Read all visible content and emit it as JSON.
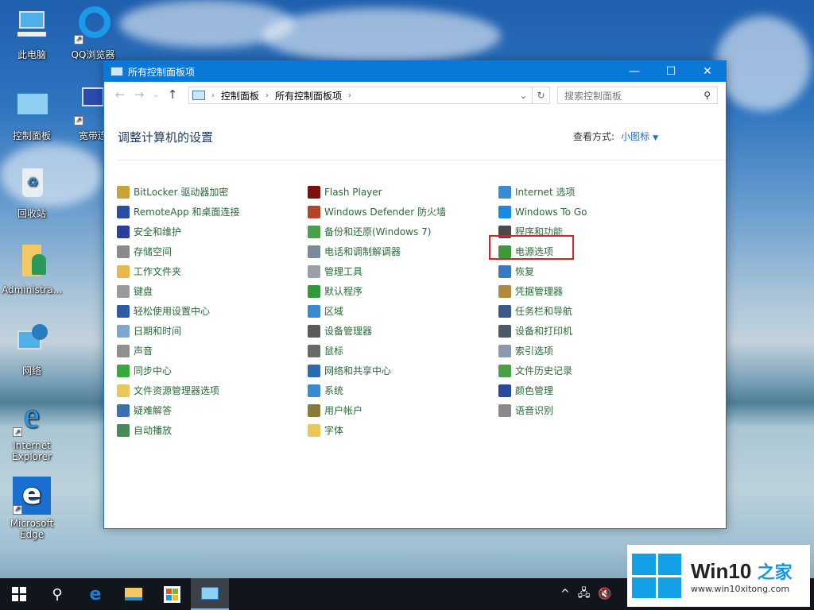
{
  "desktop": {
    "icons": [
      {
        "label": "此电脑",
        "icon": "this-pc-icon"
      },
      {
        "label": "QQ浏览器",
        "icon": "qq-browser-icon"
      },
      {
        "label": "控制面板",
        "icon": "control-panel-icon"
      },
      {
        "label": "宽带连",
        "icon": "broadband-icon"
      },
      {
        "label": "回收站",
        "icon": "recycle-bin-icon"
      },
      {
        "label": "Administra...",
        "icon": "user-folder-icon"
      },
      {
        "label": "网络",
        "icon": "network-icon"
      },
      {
        "label": "Internet Explorer",
        "icon": "ie-icon"
      },
      {
        "label": "Microsoft Edge",
        "icon": "edge-icon"
      }
    ]
  },
  "window": {
    "title": "所有控制面板项",
    "controls": {
      "minimize": "—",
      "maximize": "☐",
      "close": "✕"
    },
    "nav": {
      "back": "←",
      "forward": "→",
      "recent": "⌄",
      "up": "↑"
    },
    "breadcrumb": [
      "控制面板",
      "所有控制面板项"
    ],
    "search_placeholder": "搜索控制面板",
    "heading": "调整计算机的设置",
    "view_by_label": "查看方式:",
    "view_by_value": "小图标",
    "highlighted_item": "电源选项",
    "columns": [
      [
        {
          "label": "BitLocker 驱动器加密",
          "icon": "bitlocker-icon",
          "color": "#c9a23a"
        },
        {
          "label": "RemoteApp 和桌面连接",
          "icon": "remoteapp-icon",
          "color": "#2a4fa0"
        },
        {
          "label": "安全和维护",
          "icon": "flag-icon",
          "color": "#2a3f9a"
        },
        {
          "label": "存储空间",
          "icon": "storage-icon",
          "color": "#8a8a8a"
        },
        {
          "label": "工作文件夹",
          "icon": "work-folder-icon",
          "color": "#e8b84a"
        },
        {
          "label": "键盘",
          "icon": "keyboard-icon",
          "color": "#9a9a9a"
        },
        {
          "label": "轻松使用设置中心",
          "icon": "ease-of-access-icon",
          "color": "#2f5aa8"
        },
        {
          "label": "日期和时间",
          "icon": "clock-icon",
          "color": "#7fa6cf"
        },
        {
          "label": "声音",
          "icon": "speaker-icon",
          "color": "#8f8f8f"
        },
        {
          "label": "同步中心",
          "icon": "sync-icon",
          "color": "#3aa83a"
        },
        {
          "label": "文件资源管理器选项",
          "icon": "folder-options-icon",
          "color": "#e8c85a"
        },
        {
          "label": "疑难解答",
          "icon": "troubleshoot-icon",
          "color": "#3a6fb0"
        },
        {
          "label": "自动播放",
          "icon": "autoplay-icon",
          "color": "#4a8a5a"
        }
      ],
      [
        {
          "label": "Flash Player",
          "icon": "flash-icon",
          "color": "#7a1010"
        },
        {
          "label": "Windows Defender 防火墙",
          "icon": "firewall-icon",
          "color": "#b0452a"
        },
        {
          "label": "备份和还原(Windows 7)",
          "icon": "backup-icon",
          "color": "#4aa048"
        },
        {
          "label": "电话和调制解调器",
          "icon": "phone-icon",
          "color": "#7a8a9a"
        },
        {
          "label": "管理工具",
          "icon": "admin-tools-icon",
          "color": "#9aa0a8"
        },
        {
          "label": "默认程序",
          "icon": "default-programs-icon",
          "color": "#2e9a3a"
        },
        {
          "label": "区域",
          "icon": "region-icon",
          "color": "#3a8ad0"
        },
        {
          "label": "设备管理器",
          "icon": "device-manager-icon",
          "color": "#5a5a5a"
        },
        {
          "label": "鼠标",
          "icon": "mouse-icon",
          "color": "#6a6a6a"
        },
        {
          "label": "网络和共享中心",
          "icon": "network-sharing-icon",
          "color": "#2a6ab0"
        },
        {
          "label": "系统",
          "icon": "system-icon",
          "color": "#3a8ad0"
        },
        {
          "label": "用户帐户",
          "icon": "user-accounts-icon",
          "color": "#8a7a3a"
        },
        {
          "label": "字体",
          "icon": "fonts-icon",
          "color": "#e8c85a"
        }
      ],
      [
        {
          "label": "Internet 选项",
          "icon": "internet-options-icon",
          "color": "#3a8ad0"
        },
        {
          "label": "Windows To Go",
          "icon": "windows-to-go-icon",
          "color": "#1a8ae0"
        },
        {
          "label": "程序和功能",
          "icon": "programs-icon",
          "color": "#4a4a4a"
        },
        {
          "label": "电源选项",
          "icon": "power-options-icon",
          "color": "#3a9a3a"
        },
        {
          "label": "恢复",
          "icon": "recovery-icon",
          "color": "#3a7ac0"
        },
        {
          "label": "凭据管理器",
          "icon": "credential-icon",
          "color": "#b08a3a"
        },
        {
          "label": "任务栏和导航",
          "icon": "taskbar-icon",
          "color": "#3a5a8a"
        },
        {
          "label": "设备和打印机",
          "icon": "printer-icon",
          "color": "#4a5a6a"
        },
        {
          "label": "索引选项",
          "icon": "indexing-icon",
          "color": "#8a9aaa"
        },
        {
          "label": "文件历史记录",
          "icon": "file-history-icon",
          "color": "#4aa048"
        },
        {
          "label": "颜色管理",
          "icon": "color-management-icon",
          "color": "#2a4aa0"
        },
        {
          "label": "语音识别",
          "icon": "microphone-icon",
          "color": "#8a8a8a"
        }
      ]
    ]
  },
  "taskbar": {
    "buttons": [
      "start",
      "search",
      "edge",
      "file-explorer",
      "store",
      "control-panel"
    ],
    "active": "control-panel"
  },
  "tray": {
    "chevron": "^",
    "network": "network-icon",
    "volume": "volume-muted-icon"
  },
  "watermark": {
    "brand": "Win10",
    "brand_cn": "之家",
    "url": "www.win10xitong.com"
  }
}
